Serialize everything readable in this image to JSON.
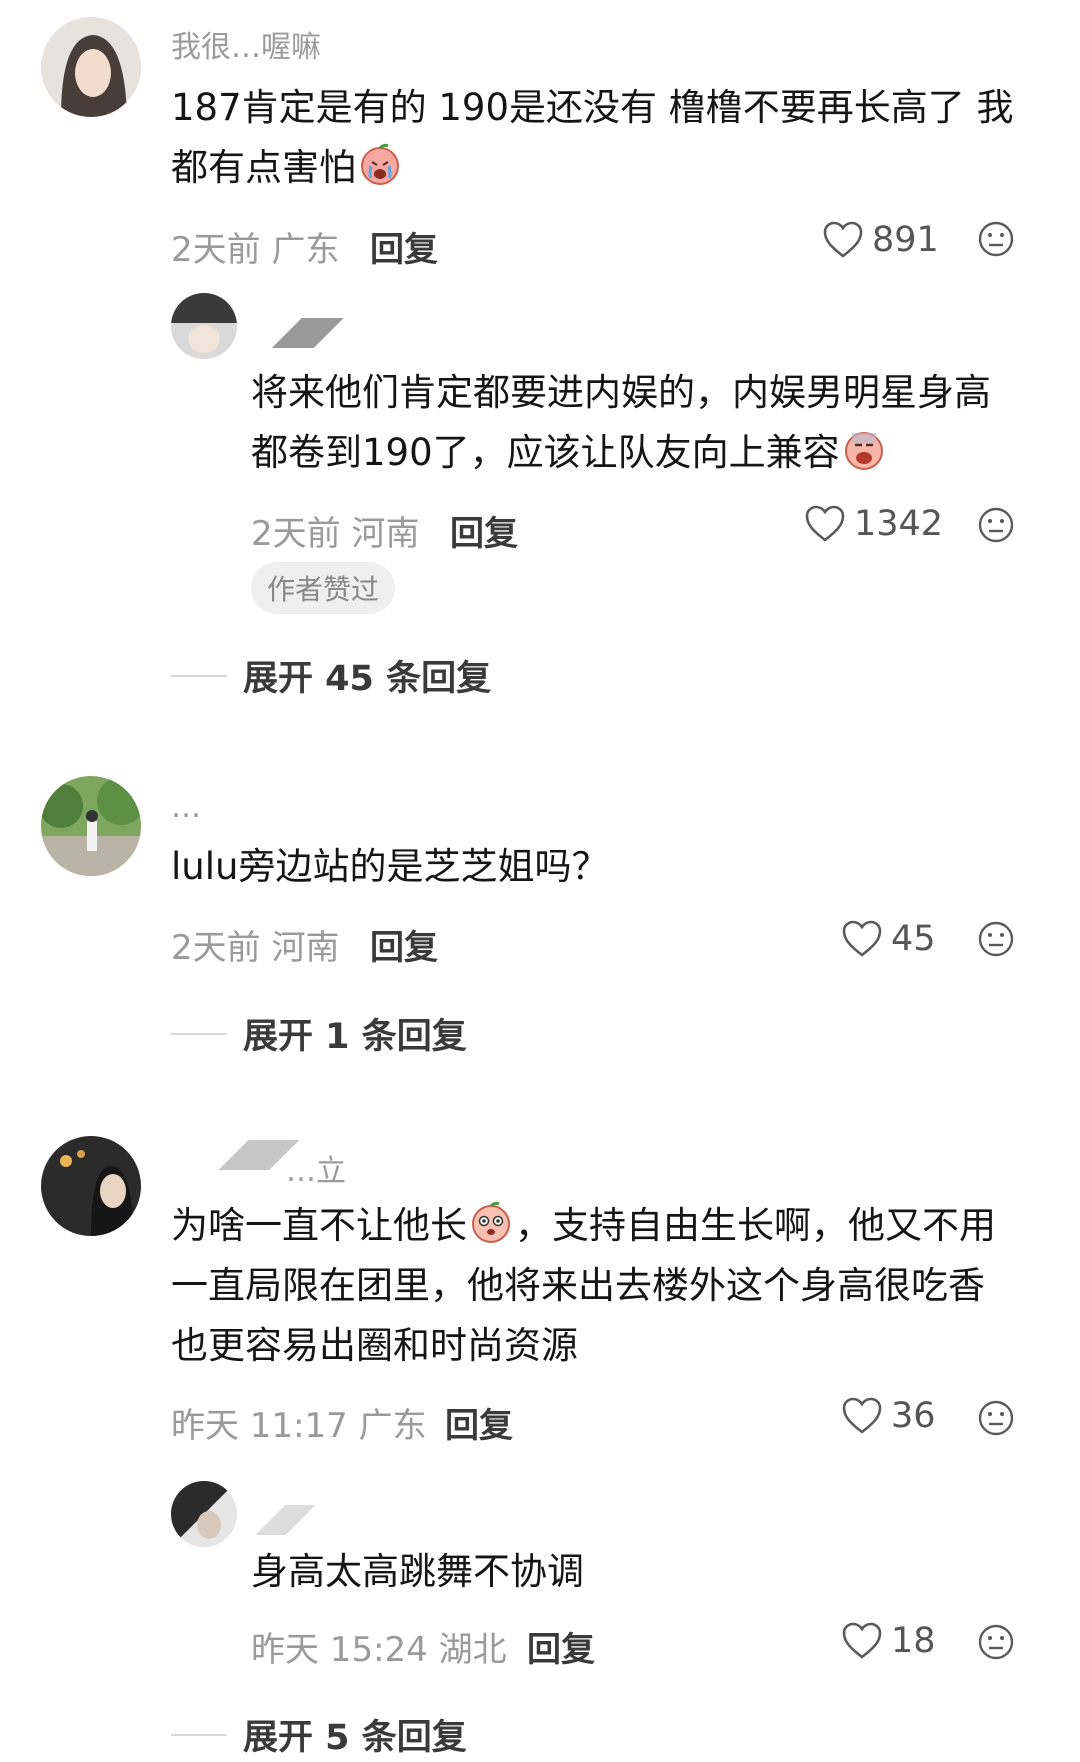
{
  "comments": [
    {
      "username": "我很…喔嘛",
      "text_line1": "187肯定是有的 190是还没有 橹橹不要再长高了 我",
      "text_line2": "都有点害怕",
      "time": "2天前",
      "location": "广东",
      "reply_label": "回复",
      "likes": "891",
      "sub": {
        "text_line1": "将来他们肯定都要进内娱的，内娱男明星身高",
        "text_line2": "都卷到190了，应该让队友向上兼容",
        "time": "2天前",
        "location": "河南",
        "reply_label": "回复",
        "likes": "1342",
        "badge": "作者赞过"
      },
      "expand_label": "展开 45 条回复"
    },
    {
      "username": "…",
      "text_line1": "lulu旁边站的是芝芝姐吗？",
      "time": "2天前",
      "location": "河南",
      "reply_label": "回复",
      "likes": "45",
      "expand_label": "展开 1 条回复"
    },
    {
      "username": "…立",
      "text_line1": "为啥一直不让他长",
      "text_line1b": "，支持自由生长啊，他又不用",
      "text_line2": "一直局限在团里，他将来出去楼外这个身高很吃香",
      "text_line3": "也更容易出圈和时尚资源",
      "time": "昨天 11:17",
      "location": "广东",
      "reply_label": "回复",
      "likes": "36",
      "sub": {
        "text_line1": "身高太高跳舞不协调",
        "time": "昨天 15:24",
        "location": "湖北",
        "reply_label": "回复",
        "likes": "18"
      },
      "expand_label": "展开 5 条回复"
    }
  ],
  "icons": {
    "like": "heart-outline-icon",
    "dislike": "neutral-face-icon",
    "emoji_1": "crying-emoji-icon",
    "emoji_2": "scared-emoji-icon",
    "emoji_3": "shocked-emoji-icon"
  }
}
